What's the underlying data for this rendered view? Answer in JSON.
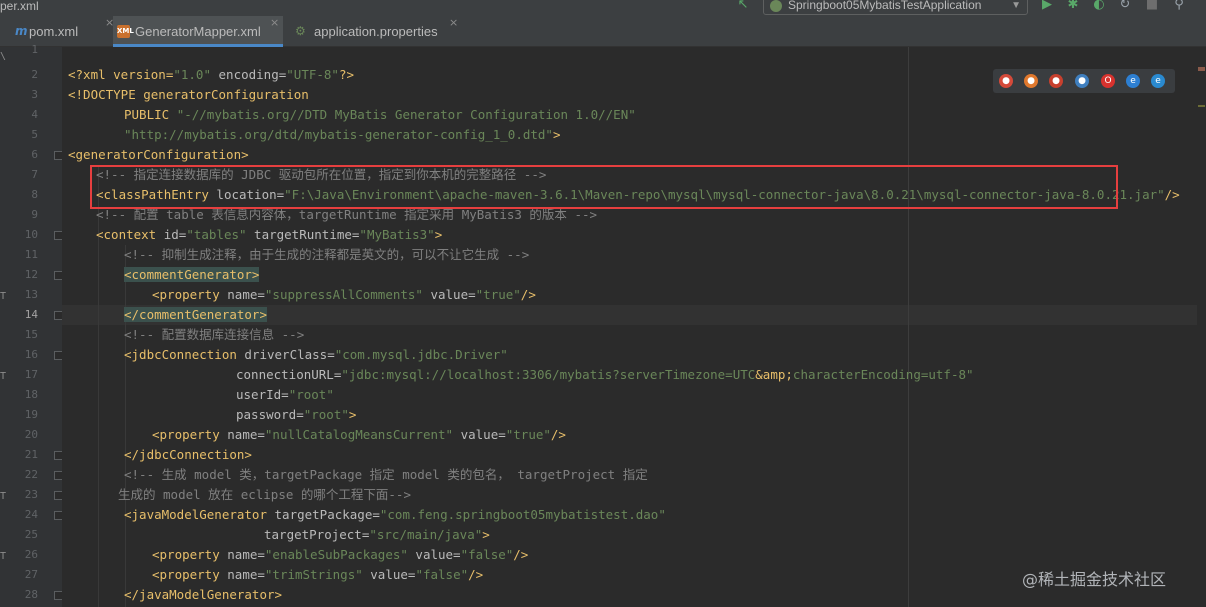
{
  "breadcrumb": "per.xml",
  "toolbar": {
    "run_config": "Springboot05MybatisTestApplication",
    "icons": [
      "hammer-icon",
      "run-icon",
      "debug-icon",
      "coverage-icon",
      "profile-icon",
      "stop-icon",
      "more-icon"
    ]
  },
  "tabs": [
    {
      "label": "pom.xml",
      "icon": "maven-icon",
      "close": "×"
    },
    {
      "label": "GeneratorMapper.xml",
      "icon": "xml-icon",
      "icon_text": "XML",
      "close": "×",
      "active": true
    },
    {
      "label": "application.properties",
      "icon": "spring-config-icon",
      "close": "×"
    }
  ],
  "gutter": {
    "line_numbers": [
      "1",
      "2",
      "3",
      "4",
      "5",
      "6",
      "7",
      "8",
      "9",
      "10",
      "11",
      "12",
      "13",
      "14",
      "15",
      "16",
      "17",
      "18",
      "19",
      "20",
      "21",
      "22",
      "23",
      "24",
      "25",
      "26",
      "27",
      "28"
    ],
    "current_line": "14",
    "left_strip_marks": [
      "\\",
      "T",
      "T",
      "T",
      "T"
    ]
  },
  "browser_icons": [
    "chrome-icon",
    "firefox-icon",
    "firefox-dev-icon",
    "safari-icon",
    "opera-icon",
    "ie-icon",
    "edge-icon"
  ],
  "code": {
    "l2": [
      "<?xml version=",
      "\"1.0\"",
      " encoding=",
      "\"UTF-8\"",
      "?>"
    ],
    "l3": [
      "<!DOCTYPE generatorConfiguration"
    ],
    "l4": [
      "PUBLIC ",
      "\"-//mybatis.org//DTD MyBatis Generator Configuration 1.0//EN\""
    ],
    "l5": [
      "\"http://mybatis.org/dtd/mybatis-generator-config_1_0.dtd\"",
      ">"
    ],
    "l6": [
      "<generatorConfiguration>"
    ],
    "l7": [
      "<!-- 指定连接数据库的 JDBC 驱动包所在位置，指定到你本机的完整路径 -->"
    ],
    "l8": [
      "<classPathEntry ",
      "location=",
      "\"F:\\Java\\Environment\\apache-maven-3.6.1\\Maven-repo\\mysql\\mysql-connector-java\\8.0.21\\mysql-connector-java-8.0.21.jar\"",
      "/>"
    ],
    "l9": [
      "<!-- 配置 table 表信息内容体，targetRuntime 指定采用 MyBatis3 的版本 -->"
    ],
    "l10": [
      "<context ",
      "id=",
      "\"tables\"",
      " targetRuntime=",
      "\"MyBatis3\"",
      ">"
    ],
    "l11": [
      "<!-- 抑制生成注释，由于生成的注释都是英文的，可以不让它生成 -->"
    ],
    "l12": [
      "<commentGenerator>"
    ],
    "l13": [
      "<property ",
      "name=",
      "\"suppressAllComments\"",
      " value=",
      "\"true\"",
      "/>"
    ],
    "l14": [
      "</commentGenerator>"
    ],
    "l15": [
      "<!-- 配置数据库连接信息 -->"
    ],
    "l16": [
      "<jdbcConnection ",
      "driverClass=",
      "\"com.mysql.jdbc.Driver\""
    ],
    "l17": [
      "connectionURL=",
      "\"jdbc:mysql://localhost:3306/mybatis?serverTimezone=UTC",
      "&amp;",
      "characterEncoding=utf-8\""
    ],
    "l18": [
      "userId=",
      "\"root\""
    ],
    "l19": [
      "password=",
      "\"root\"",
      ">"
    ],
    "l20": [
      "<property ",
      "name=",
      "\"nullCatalogMeansCurrent\"",
      " value=",
      "\"true\"",
      "/>"
    ],
    "l21": [
      "</jdbcConnection>"
    ],
    "l22": [
      "<!-- 生成 model 类，targetPackage 指定 model 类的包名， targetProject 指定"
    ],
    "l23": [
      "生成的 model 放在 eclipse 的哪个工程下面-->"
    ],
    "l24": [
      "<javaModelGenerator ",
      "targetPackage=",
      "\"com.feng.springboot05mybatistest.dao\""
    ],
    "l25": [
      "targetProject=",
      "\"src/main/java\"",
      ">"
    ],
    "l26": [
      "<property ",
      "name=",
      "\"enableSubPackages\"",
      " value=",
      "\"false\"",
      "/>"
    ],
    "l27": [
      "<property ",
      "name=",
      "\"trimStrings\"",
      " value=",
      "\"false\"",
      "/>"
    ],
    "l28": [
      "</javaModelGenerator>"
    ]
  },
  "watermark": "@稀土掘金技术社区",
  "colors": {
    "background": "#2b2b2b",
    "tag": "#e8bf6a",
    "attribute_value": "#6a8759",
    "comment": "#808080",
    "highlight_box": "#e63f3f",
    "active_tab_underline": "#4a88c7"
  }
}
